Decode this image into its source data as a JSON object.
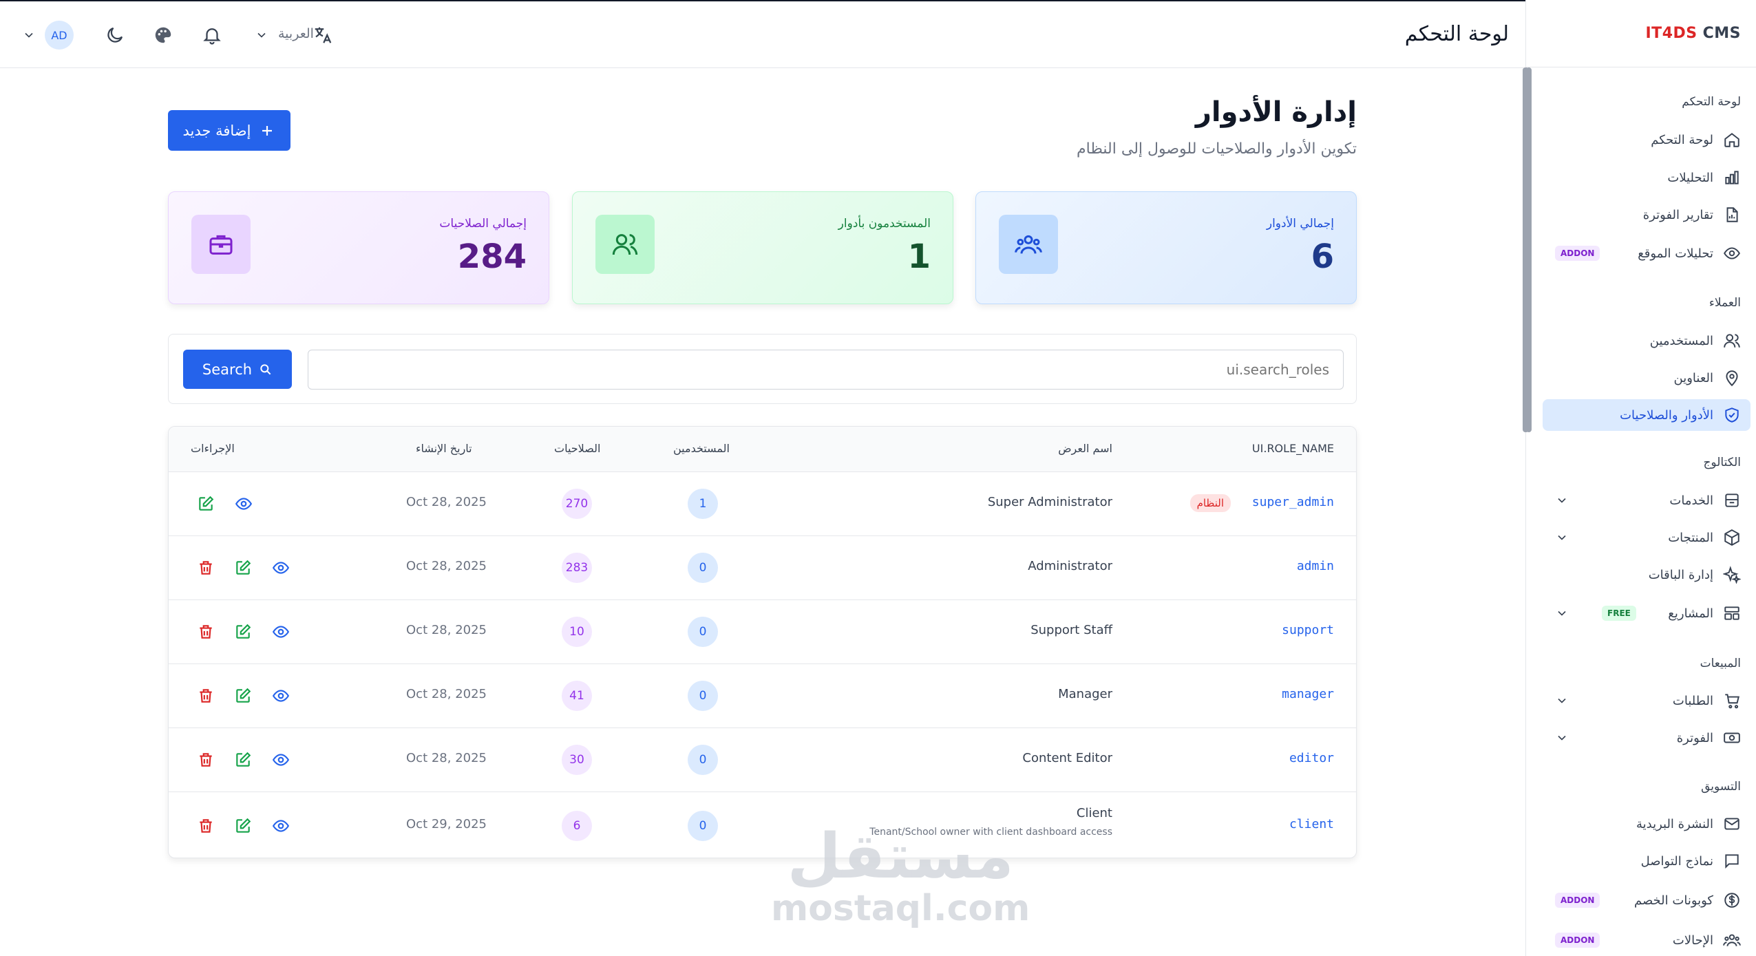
{
  "brand": {
    "accent": "IT4DS",
    "name": "CMS"
  },
  "header": {
    "title": "لوحة التحكم",
    "language": "العربية",
    "avatar_initials": "AD"
  },
  "sidebar": {
    "sections": [
      {
        "label": "لوحة التحكم"
      },
      {
        "label": "العملاء"
      },
      {
        "label": "الكتالوج"
      },
      {
        "label": "المبيعات"
      },
      {
        "label": "التسويق"
      }
    ],
    "items": [
      {
        "label": "لوحة التحكم",
        "icon": "home-icon"
      },
      {
        "label": "التحليلات",
        "icon": "bar-chart-icon"
      },
      {
        "label": "تقارير الفوترة",
        "icon": "file-chart-icon"
      },
      {
        "label": "تحليلات الموقع",
        "icon": "eye-icon",
        "badge": "ADDON"
      },
      {
        "label": "المستخدمين",
        "icon": "users-icon"
      },
      {
        "label": "العناوين",
        "icon": "map-pin-icon"
      },
      {
        "label": "الأدوار والصلاحيات",
        "icon": "shield-check-icon",
        "active": true
      },
      {
        "label": "الخدمات",
        "icon": "archive-icon"
      },
      {
        "label": "المنتجات",
        "icon": "package-icon"
      },
      {
        "label": "إدارة الباقات",
        "icon": "sparkles-icon"
      },
      {
        "label": "المشاريع",
        "icon": "layout-icon",
        "badge": "FREE"
      },
      {
        "label": "الطلبات",
        "icon": "cart-icon"
      },
      {
        "label": "الفوترة",
        "icon": "banknote-icon"
      },
      {
        "label": "النشرة البريدية",
        "icon": "mail-icon"
      },
      {
        "label": "نماذج التواصل",
        "icon": "message-icon"
      },
      {
        "label": "كوبونات الخصم",
        "icon": "dollar-circle-icon",
        "badge": "ADDON"
      },
      {
        "label": "الإحالات",
        "icon": "users-group-icon",
        "badge": "ADDON"
      }
    ]
  },
  "page": {
    "title": "إدارة الأدوار",
    "subtitle": "تكوين الأدوار والصلاحيات للوصول إلى النظام",
    "add_button": "إضافة جديد"
  },
  "stats": [
    {
      "label": "إجمالي الأدوار",
      "value": "6",
      "color": "#1d4ed8"
    },
    {
      "label": "المستخدمون بأدوار",
      "value": "1",
      "color": "#15803d"
    },
    {
      "label": "إجمالي الصلاحيات",
      "value": "284",
      "color": "#7e22ce"
    }
  ],
  "search": {
    "placeholder": "ui.search_roles",
    "button": "Search"
  },
  "table": {
    "headers": {
      "role_name": "UI.ROLE_NAME",
      "display_name": "اسم العرض",
      "users": "المستخدمين",
      "permissions": "الصلاحيات",
      "created": "تاريخ الإنشاء",
      "actions": "الإجراءات"
    },
    "rows": [
      {
        "role": "super_admin",
        "system_badge": "النظام",
        "display": "Super Administrator",
        "users": "1",
        "permissions": "270",
        "date": "Oct 28, 2025"
      },
      {
        "role": "admin",
        "display": "Administrator",
        "users": "0",
        "permissions": "283",
        "date": "Oct 28, 2025"
      },
      {
        "role": "support",
        "display": "Support Staff",
        "users": "0",
        "permissions": "10",
        "date": "Oct 28, 2025"
      },
      {
        "role": "manager",
        "display": "Manager",
        "users": "0",
        "permissions": "41",
        "date": "Oct 28, 2025"
      },
      {
        "role": "editor",
        "display": "Content Editor",
        "users": "0",
        "permissions": "30",
        "date": "Oct 28, 2025"
      },
      {
        "role": "client",
        "display": "Client",
        "description": "Tenant/School owner with client dashboard access",
        "users": "0",
        "permissions": "6",
        "date": "Oct 29, 2025"
      }
    ]
  },
  "watermark": {
    "arabic": "مستقل",
    "latin": "mostaql.com"
  }
}
